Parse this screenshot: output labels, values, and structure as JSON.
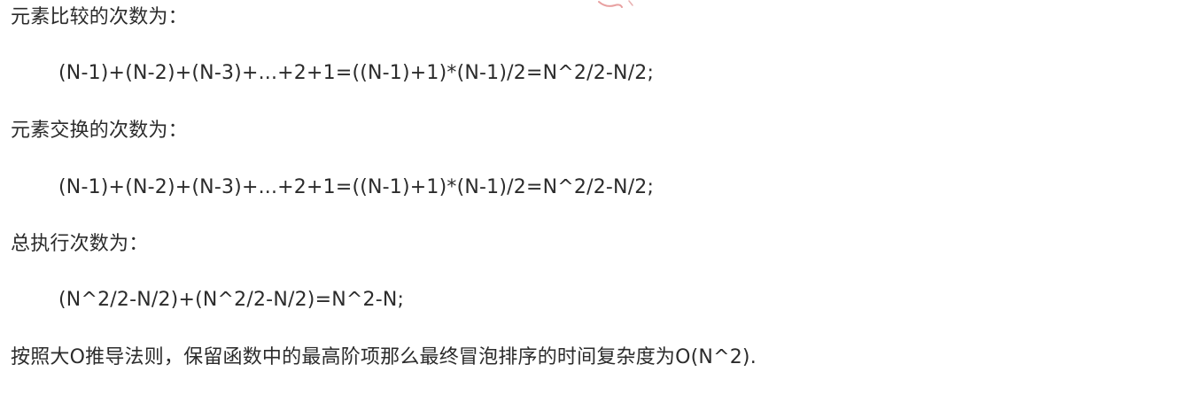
{
  "lines": {
    "compare_heading": "元素比较的次数为：",
    "compare_formula": "(N-1)+(N-2)+(N-3)+...+2+1=((N-1)+1)*(N-1)/2=N^2/2-N/2;",
    "swap_heading": "元素交换的次数为：",
    "swap_formula": "(N-1)+(N-2)+(N-3)+...+2+1=((N-1)+1)*(N-1)/2=N^2/2-N/2;",
    "total_heading": "总执行次数为：",
    "total_formula": "(N^2/2-N/2)+(N^2/2-N/2)=N^2-N;",
    "conclusion": "按照大O推导法则，保留函数中的最高阶项那么最终冒泡排序的时间复杂度为O(N^2)."
  },
  "colors": {
    "text": "#2b2b2b",
    "mark": "#e8a0a0"
  }
}
